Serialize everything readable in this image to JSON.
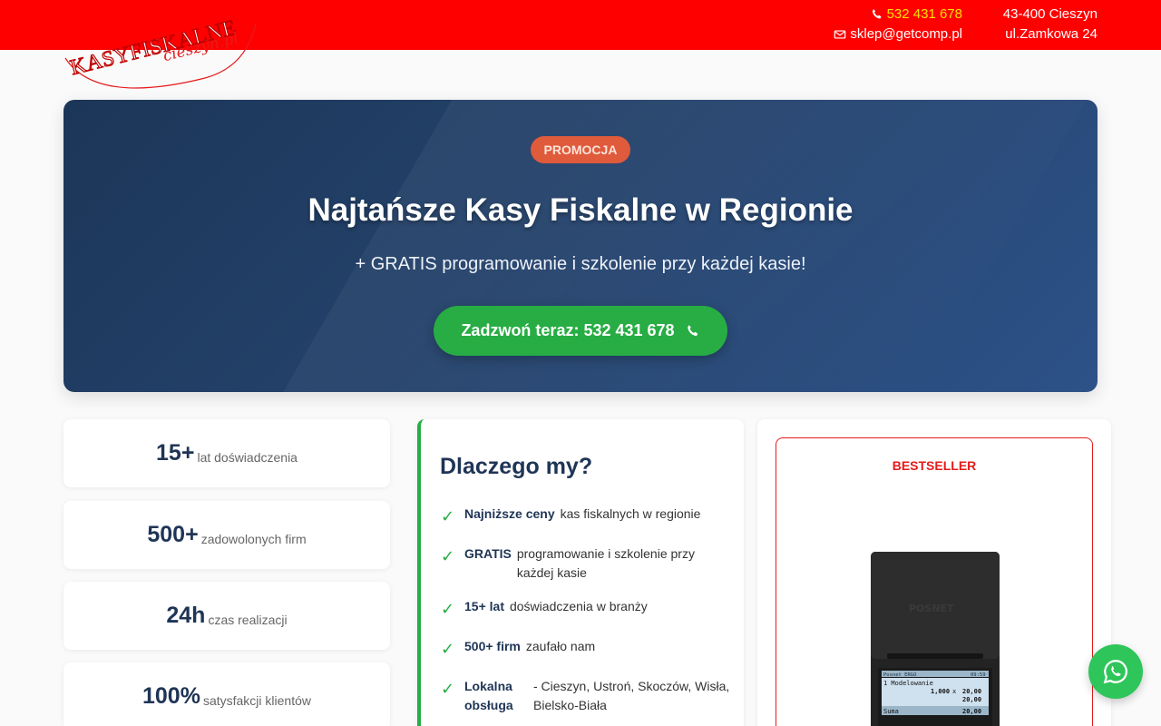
{
  "header": {
    "phone": "532 431 678",
    "email": "sklep@getcomp.pl",
    "address_city": "43-400 Cieszyn",
    "address_street": "ul.Zamkowa 24",
    "brand_color": "#ff0000",
    "phone_color": "#ffe000"
  },
  "logo": {
    "line1": "KASYFISKALNE",
    "line2": "cieszyn.pl"
  },
  "hero": {
    "badge": "PROMOCJA",
    "title": "Najtańsze Kasy Fiskalne w Regionie",
    "subtitle": "+ GRATIS programowanie i szkolenie przy każdej kasie!",
    "cta_label": "Zadzwoń teraz: 532 431 678"
  },
  "stats": [
    {
      "number": "15+",
      "label": "lat doświadczenia"
    },
    {
      "number": "500+",
      "label": "zadowolonych firm"
    },
    {
      "number": "24h",
      "label": "czas realizacji"
    },
    {
      "number": "100%",
      "label": "satysfakcji klientów"
    }
  ],
  "why": {
    "title": "Dlaczego my?",
    "items": [
      {
        "bold": "Najniższe ceny",
        "text": "kas fiskalnych w regionie"
      },
      {
        "bold": "GRATIS",
        "text": "programowanie i szkolenie przy każdej kasie"
      },
      {
        "bold": "15+ lat",
        "text": "doświadczenia w branży"
      },
      {
        "bold": "500+ firm",
        "text": "zaufało nam"
      },
      {
        "bold": "Lokalna obsługa",
        "text": "- Cieszyn, Ustroń, Skoczów, Wisła, Bielsko-Biała"
      }
    ]
  },
  "product": {
    "badge": "BESTSELLER",
    "brand": "POSNET",
    "screen_line1": "1 Modelowanie",
    "screen_qty": "1,000",
    "screen_x": "x",
    "screen_price": "20,00",
    "screen_total_label": "Suma",
    "screen_total": "20,00",
    "screen_top": "Posnet ERGO",
    "screen_time": "09:59"
  },
  "colors": {
    "accent_green": "#27ad44",
    "hero_blue": "#24426b",
    "badge_orange": "#e05a3c",
    "text_navy": "#1f3556"
  },
  "icons": {
    "phone": "phone-icon",
    "email": "envelope-icon",
    "whatsapp": "whatsapp-icon",
    "check": "check-icon"
  }
}
